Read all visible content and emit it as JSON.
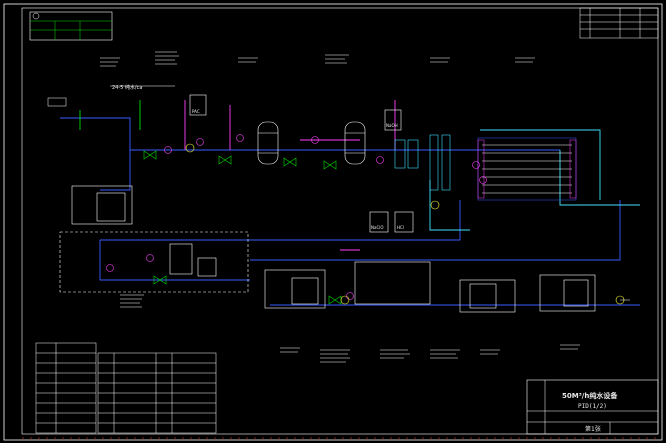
{
  "drawing": {
    "title_line1": "50M³/h纯水设备",
    "title_line2": "PID(1/2)",
    "sheet_label": "第1张",
    "callout_text": "24-5 纯水/ca",
    "tank_label_1": "PAC",
    "tank_label_2": "NaOH",
    "tank_label_3": "NaClO",
    "tank_label_4": "HCl"
  },
  "colors": {
    "background": "#000000",
    "frame": "#ffffff",
    "main_pipe": "#3a5cff",
    "chem_pipe": "#ff40ff",
    "water_pipe": "#40e0ff",
    "green_line": "#00e000",
    "yellow_mark": "#ffff40",
    "red_mark": "#ff3030"
  },
  "icons": {
    "equipment": "vessel-icon",
    "pump": "pump-icon",
    "valve": "valve-icon",
    "instrument": "instrument-bubble-icon",
    "membrane": "membrane-rack-icon"
  }
}
